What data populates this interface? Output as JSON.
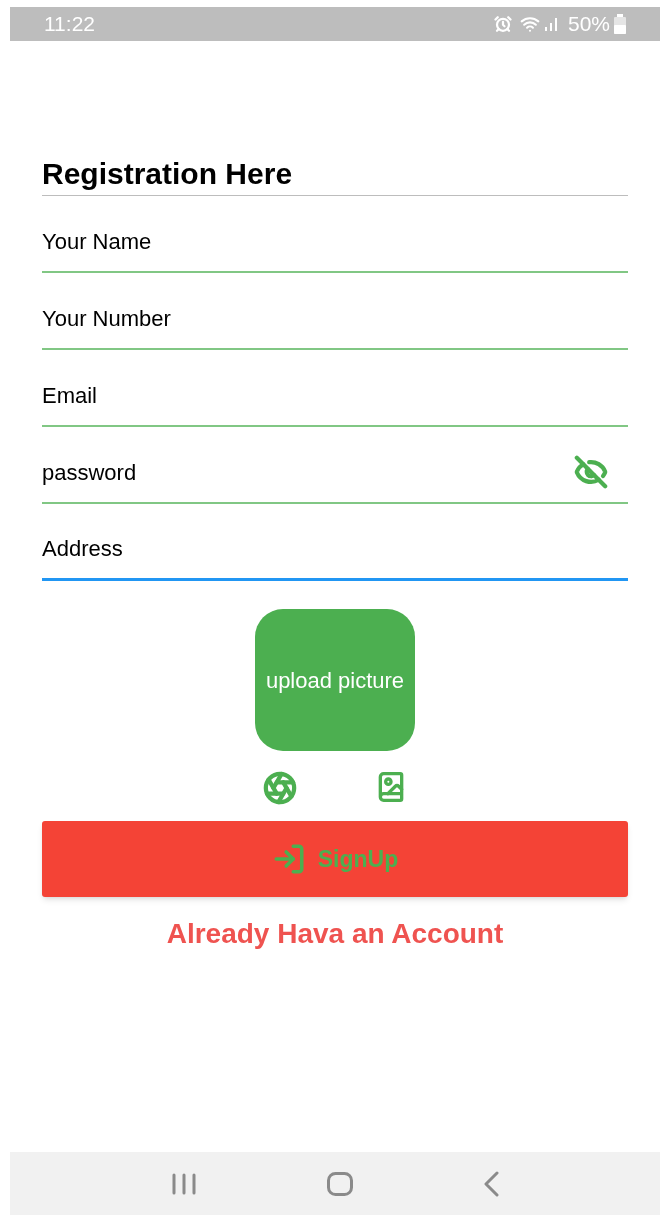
{
  "status_bar": {
    "time": "11:22",
    "battery": "50%"
  },
  "title": "Registration Here",
  "fields": [
    {
      "kind": "text",
      "placeholder": "Your Name",
      "focused": false
    },
    {
      "kind": "text",
      "placeholder": "Your Number",
      "focused": false
    },
    {
      "kind": "text",
      "placeholder": "Email",
      "focused": false
    },
    {
      "kind": "password",
      "placeholder": "password",
      "focused": false
    },
    {
      "kind": "text",
      "placeholder": "Address",
      "focused": true
    }
  ],
  "upload": {
    "label": "upload picture"
  },
  "signup_button": {
    "label": "SignUp"
  },
  "login_link": "Already Hava an Account"
}
